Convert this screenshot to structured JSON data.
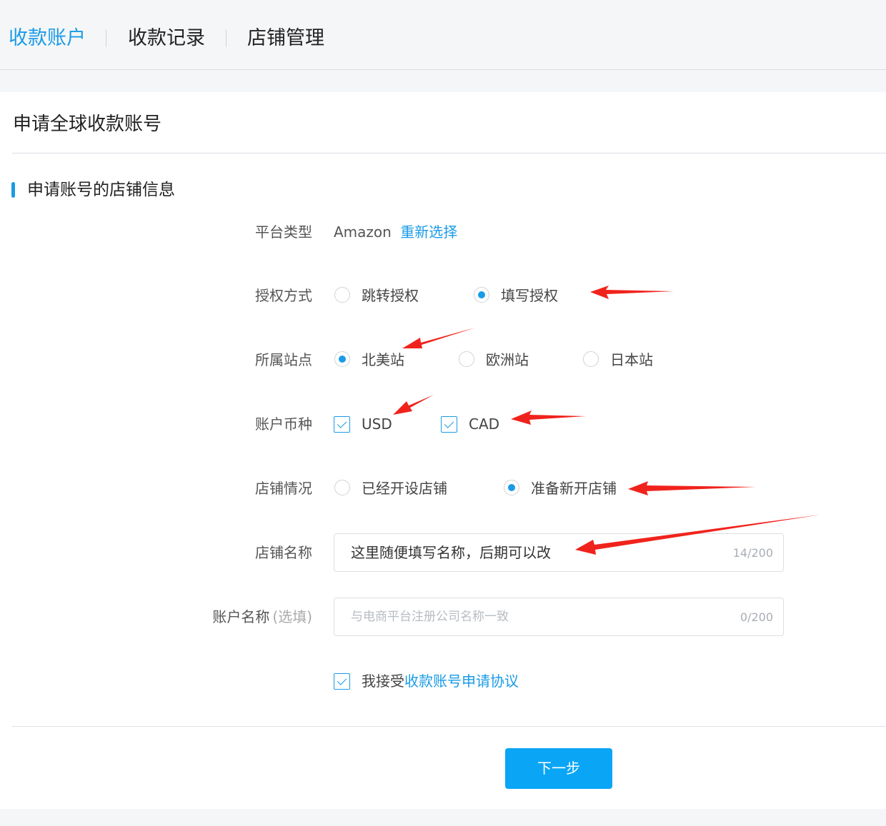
{
  "nav": {
    "tabs": [
      {
        "label": "收款账户",
        "active": true
      },
      {
        "label": "收款记录",
        "active": false
      },
      {
        "label": "店铺管理",
        "active": false
      }
    ]
  },
  "page": {
    "title": "申请全球收款账号",
    "section_title": "申请账号的店铺信息"
  },
  "form": {
    "platform": {
      "label": "平台类型",
      "value": "Amazon",
      "reselect": "重新选择"
    },
    "auth": {
      "label": "授权方式",
      "options": [
        "跳转授权",
        "填写授权"
      ],
      "selected": "填写授权"
    },
    "site": {
      "label": "所属站点",
      "options": [
        "北美站",
        "欧洲站",
        "日本站"
      ],
      "selected": "北美站"
    },
    "currency": {
      "label": "账户币种",
      "options": [
        "USD",
        "CAD"
      ],
      "checked": [
        "USD",
        "CAD"
      ]
    },
    "store_status": {
      "label": "店铺情况",
      "options": [
        "已经开设店铺",
        "准备新开店铺"
      ],
      "selected": "准备新开店铺"
    },
    "store_name": {
      "label": "店铺名称",
      "value": "这里随便填写名称，后期可以改",
      "counter": "14/200"
    },
    "account_name": {
      "label": "账户名称",
      "optional": "(选填)",
      "placeholder": "与电商平台注册公司名称一致",
      "counter": "0/200"
    },
    "agreement": {
      "prefix": "我接受",
      "link": "收款账号申请协议",
      "checked": true
    }
  },
  "actions": {
    "next": "下一步"
  },
  "colors": {
    "accent": "#1a9be6",
    "button": "#0aa6f5",
    "annotation": "#f0231c"
  }
}
